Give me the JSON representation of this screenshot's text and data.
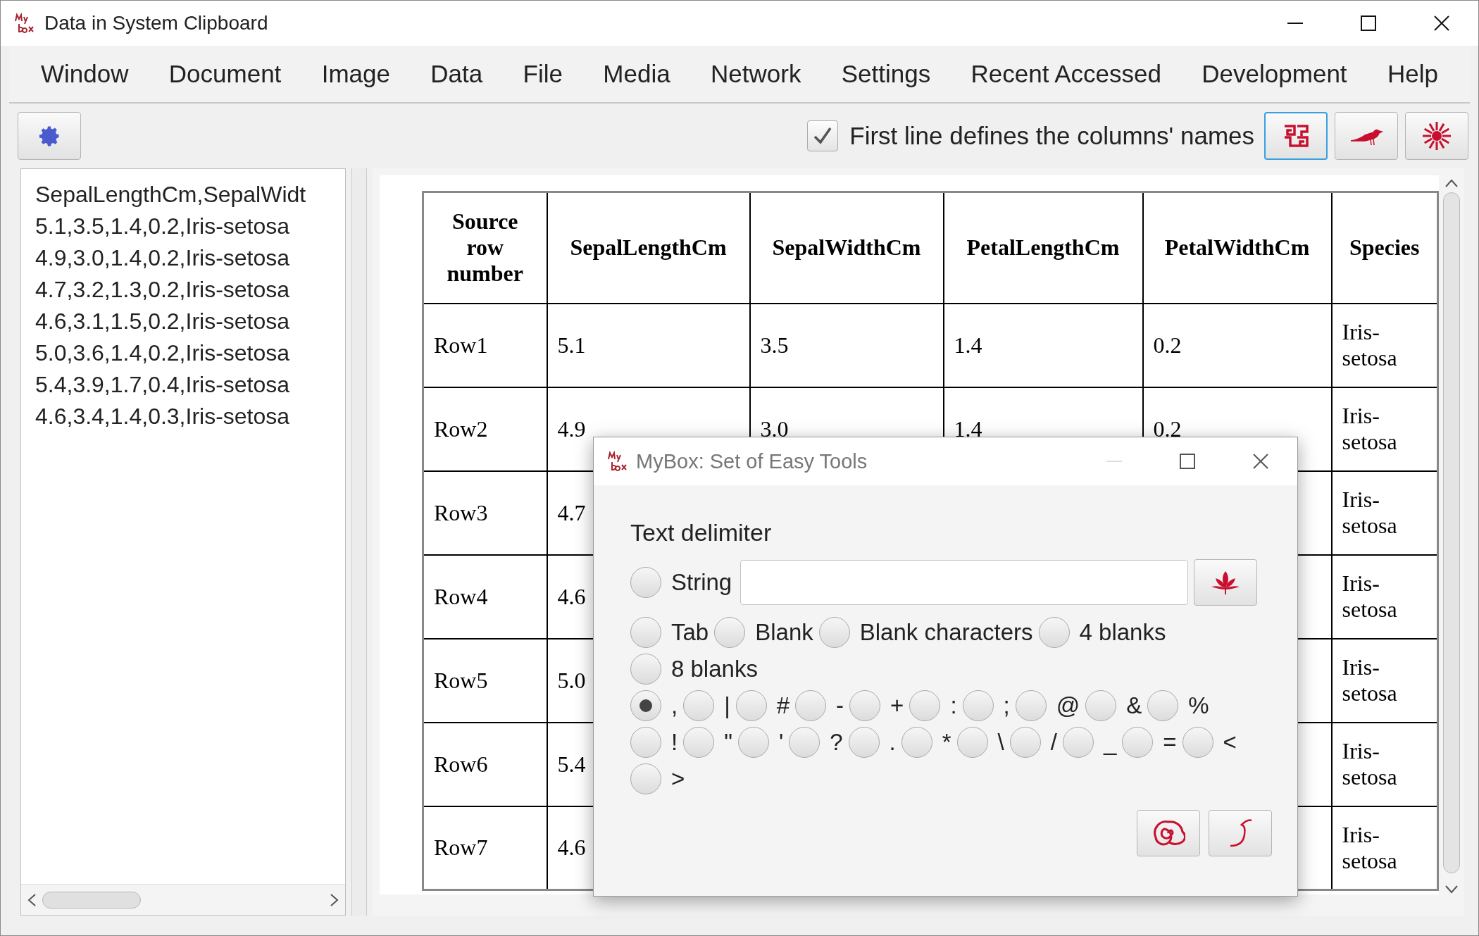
{
  "window": {
    "title": "Data in System Clipboard"
  },
  "menu": [
    "Window",
    "Document",
    "Image",
    "Data",
    "File",
    "Media",
    "Network",
    "Settings",
    "Recent Accessed",
    "Development",
    "Help"
  ],
  "toolbar": {
    "first_line_names": {
      "label": "First line defines the columns' names",
      "checked": true
    }
  },
  "source_text": {
    "lines": [
      "SepalLengthCm,SepalWidt",
      "5.1,3.5,1.4,0.2,Iris-setosa",
      "4.9,3.0,1.4,0.2,Iris-setosa",
      "4.7,3.2,1.3,0.2,Iris-setosa",
      "4.6,3.1,1.5,0.2,Iris-setosa",
      "5.0,3.6,1.4,0.2,Iris-setosa",
      "5.4,3.9,1.7,0.4,Iris-setosa",
      "4.6,3.4,1.4,0.3,Iris-setosa"
    ]
  },
  "table": {
    "columns": [
      "Source row number",
      "SepalLengthCm",
      "SepalWidthCm",
      "PetalLengthCm",
      "PetalWidthCm",
      "Species"
    ],
    "rows": [
      {
        "cells": [
          "Row1",
          "5.1",
          "3.5",
          "1.4",
          "0.2",
          "Iris-setosa"
        ]
      },
      {
        "cells": [
          "Row2",
          "4.9",
          "3.0",
          "1.4",
          "0.2",
          "Iris-setosa"
        ]
      },
      {
        "cells": [
          "Row3",
          "4.7",
          null,
          null,
          null,
          "Iris-setosa"
        ]
      },
      {
        "cells": [
          "Row4",
          "4.6",
          null,
          null,
          null,
          "Iris-setosa"
        ]
      },
      {
        "cells": [
          "Row5",
          "5.0",
          null,
          null,
          null,
          "Iris-setosa"
        ]
      },
      {
        "cells": [
          "Row6",
          "5.4",
          null,
          null,
          null,
          "Iris-setosa"
        ]
      },
      {
        "cells": [
          "Row7",
          "4.6",
          null,
          null,
          null,
          "Iris-setosa"
        ]
      }
    ]
  },
  "dialog": {
    "title": "MyBox: Set of Easy Tools",
    "section": "Text delimiter",
    "string_option": {
      "label": "String",
      "selected": false
    },
    "delimiter_rows": [
      [
        {
          "label": "Tab",
          "selected": false
        },
        {
          "label": "Blank",
          "selected": false
        },
        {
          "label": "Blank characters",
          "selected": false
        },
        {
          "label": "4 blanks",
          "selected": false
        }
      ],
      [
        {
          "label": "8 blanks",
          "selected": false
        }
      ],
      [
        {
          "label": ",",
          "selected": true
        },
        {
          "label": "|",
          "selected": false
        },
        {
          "label": "#",
          "selected": false
        },
        {
          "label": "-",
          "selected": false
        },
        {
          "label": "+",
          "selected": false
        },
        {
          "label": ":",
          "selected": false
        },
        {
          "label": ";",
          "selected": false
        },
        {
          "label": "@",
          "selected": false
        },
        {
          "label": "&",
          "selected": false
        },
        {
          "label": "%",
          "selected": false
        }
      ],
      [
        {
          "label": "!",
          "selected": false
        },
        {
          "label": "\"",
          "selected": false
        },
        {
          "label": "'",
          "selected": false
        },
        {
          "label": "?",
          "selected": false
        },
        {
          "label": ".",
          "selected": false
        },
        {
          "label": "*",
          "selected": false
        },
        {
          "label": "\\",
          "selected": false
        },
        {
          "label": "/",
          "selected": false
        },
        {
          "label": "_",
          "selected": false
        },
        {
          "label": "=",
          "selected": false
        },
        {
          "label": "<",
          "selected": false
        }
      ],
      [
        {
          "label": ">",
          "selected": false
        }
      ]
    ]
  }
}
